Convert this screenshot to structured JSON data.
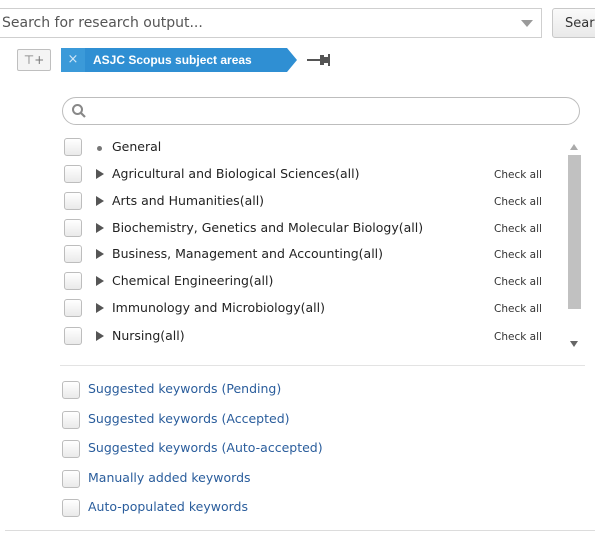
{
  "search": {
    "placeholder": "Search for research output...",
    "button_label": "Sear"
  },
  "filter_bar": {
    "chip_label": "ASJC Scopus subject areas",
    "remove_glyph": "×",
    "add_filter_glyph": "⊤+"
  },
  "panel": {
    "tree_items": [
      {
        "label": "General",
        "marker": "bullet",
        "check_all": ""
      },
      {
        "label": "Agricultural and Biological Sciences(all)",
        "marker": "expander",
        "check_all": "Check all"
      },
      {
        "label": "Arts and Humanities(all)",
        "marker": "expander",
        "check_all": "Check all"
      },
      {
        "label": "Biochemistry, Genetics and Molecular Biology(all)",
        "marker": "expander",
        "check_all": "Check all"
      },
      {
        "label": "Business, Management and Accounting(all)",
        "marker": "expander",
        "check_all": "Check all"
      },
      {
        "label": "Chemical Engineering(all)",
        "marker": "expander",
        "check_all": "Check all"
      },
      {
        "label": "Immunology and Microbiology(all)",
        "marker": "expander",
        "check_all": "Check all"
      },
      {
        "label": "Nursing(all)",
        "marker": "expander",
        "check_all": "Check all"
      }
    ],
    "keyword_options": [
      {
        "label": "Suggested keywords (Pending)"
      },
      {
        "label": "Suggested keywords (Accepted)"
      },
      {
        "label": "Suggested keywords (Auto-accepted)"
      },
      {
        "label": "Manually added keywords"
      },
      {
        "label": "Auto-populated keywords"
      }
    ]
  },
  "colors": {
    "chip_background": "#2f8fd3",
    "keyword_text": "#2a5d9c"
  }
}
